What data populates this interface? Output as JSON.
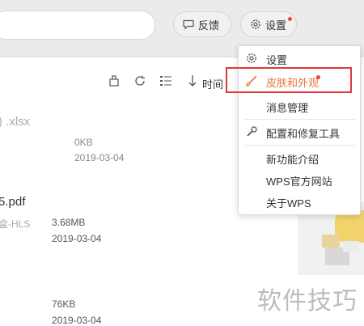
{
  "header": {
    "feedback_label": "反馈",
    "settings_label": "设置"
  },
  "toolbar": {
    "sort_label": "时间"
  },
  "files": [
    {
      "name": ") .xlsx",
      "size": "0KB",
      "date": "2019-03-04"
    },
    {
      "name": "5.pdf",
      "owner": "盒-HLS",
      "size": "3.68MB",
      "date": "2019-03-04"
    },
    {
      "size": "76KB",
      "date": "2019-03-04"
    }
  ],
  "menu": {
    "items": [
      {
        "label": "设置",
        "icon": "gear-icon"
      },
      {
        "label": "皮肤和外观",
        "icon": "brush-icon",
        "highlighted": true
      },
      {
        "label": "消息管理"
      },
      {
        "label": "配置和修复工具",
        "icon": "wrench-icon"
      },
      {
        "label": "新功能介绍"
      },
      {
        "label": "WPS官方网站"
      },
      {
        "label": "关于WPS"
      }
    ]
  },
  "watermark": "软件技巧",
  "colors": {
    "accent_orange": "#e8743b",
    "highlight_red": "#e0393b",
    "badge_red": "#e0494a"
  }
}
